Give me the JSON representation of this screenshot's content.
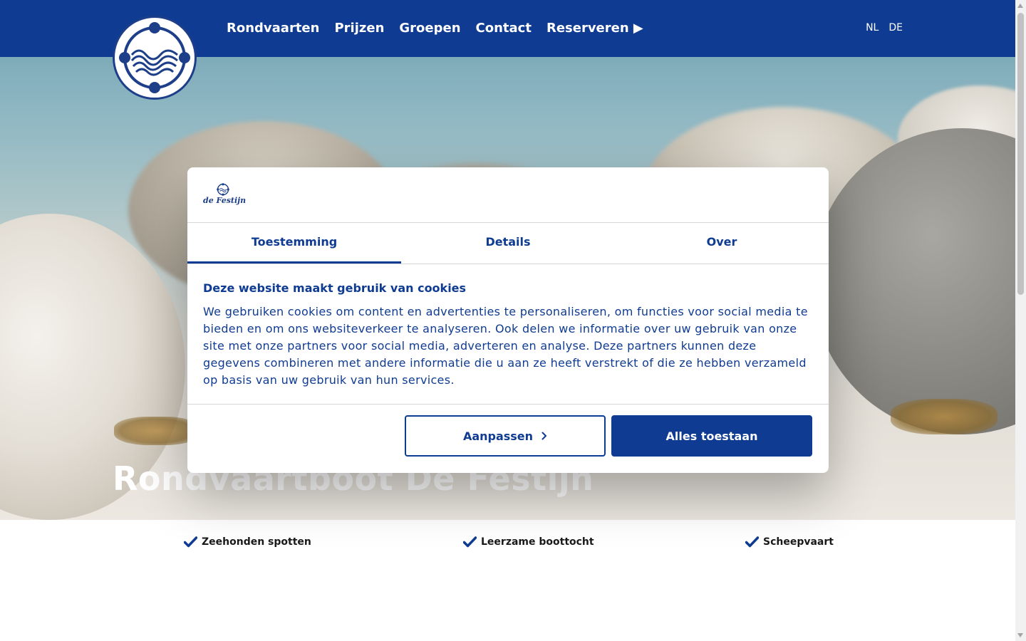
{
  "header": {
    "nav": [
      {
        "label": "Rondvaarten"
      },
      {
        "label": "Prijzen"
      },
      {
        "label": "Groepen"
      },
      {
        "label": "Contact"
      },
      {
        "label": "Reserveren ▶"
      }
    ],
    "languages": [
      "NL",
      "DE"
    ]
  },
  "hero": {
    "title": "Rondvaartboot De Festijn"
  },
  "features": [
    {
      "label": "Zeehonden spotten",
      "icon": "check-icon"
    },
    {
      "label": "Leerzame boottocht",
      "icon": "check-icon"
    },
    {
      "label": "Scheepvaart",
      "icon": "check-icon"
    }
  ],
  "cookie_dialog": {
    "brand": "de Festijn",
    "tabs": [
      {
        "label": "Toestemming",
        "active": true
      },
      {
        "label": "Details",
        "active": false
      },
      {
        "label": "Over",
        "active": false
      }
    ],
    "title": "Deze website maakt gebruik van cookies",
    "text": "We gebruiken cookies om content en advertenties te personaliseren, om functies voor social media te bieden en om ons websiteverkeer te analyseren. Ook delen we informatie over uw gebruik van onze site met onze partners voor social media, adverteren en analyse. Deze partners kunnen deze gegevens combineren met andere informatie die u aan ze heeft verstrekt of die ze hebben verzameld op basis van uw gebruik van hun services.",
    "customize_label": "Aanpassen",
    "allow_all_label": "Alles toestaan"
  },
  "colors": {
    "brand_blue": "#0f3c92",
    "white": "#ffffff"
  }
}
